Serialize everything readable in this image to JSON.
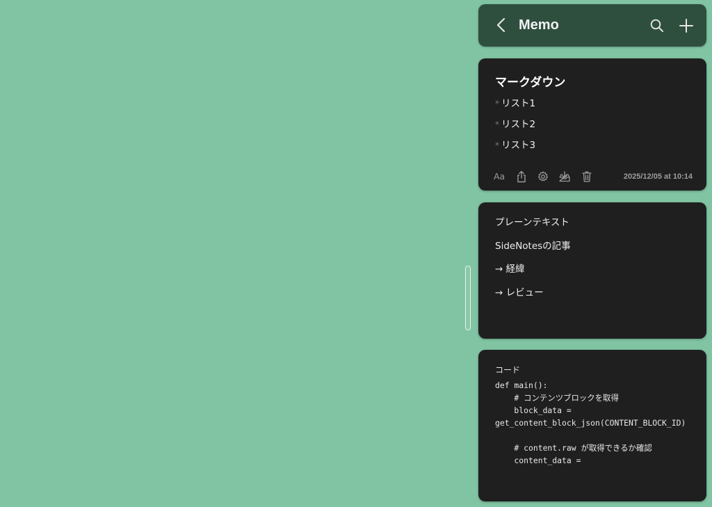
{
  "header": {
    "title": "Memo",
    "back_icon": "chevron-left-icon",
    "search_icon": "search-icon",
    "add_icon": "plus-icon",
    "color": "#2f4f3e"
  },
  "background_color": "#80c4a3",
  "notes": [
    {
      "heading": "マークダウン",
      "list": [
        {
          "bullet": "*",
          "text": "リスト1"
        },
        {
          "bullet": "*",
          "text": "リスト2"
        },
        {
          "bullet": "*",
          "text": "リスト3"
        }
      ],
      "toolbar": {
        "font_label": "Aa",
        "icons": [
          "share-icon",
          "gear-icon",
          "download-tray-icon",
          "trash-icon"
        ]
      },
      "timestamp": "2025/12/05 at 10:14"
    },
    {
      "lines": [
        "プレーンテキスト",
        "SideNotesの記事",
        "→ 経緯",
        "→ レビュー"
      ]
    },
    {
      "label": "コード",
      "code": "def main():\n    # コンテンツブロックを取得\n    block_data =\nget_content_block_json(CONTENT_BLOCK_ID)\n\n    # content.raw が取得できるか確認\n    content_data ="
    }
  ]
}
